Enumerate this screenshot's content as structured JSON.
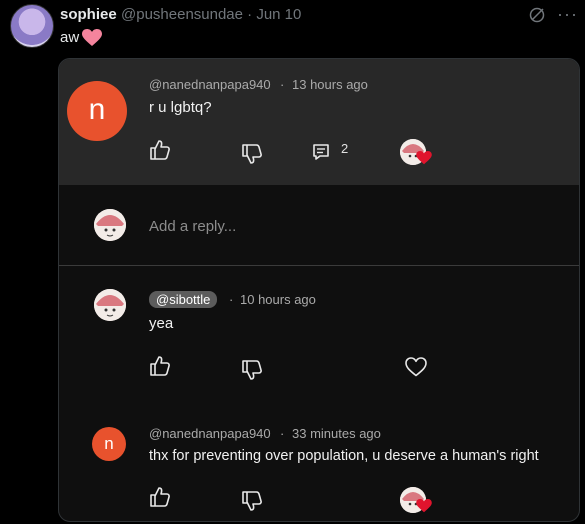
{
  "tweet": {
    "display_name": "sophiee",
    "handle_and_date": "@pusheensundae · Jun 10",
    "text": "aw",
    "emoji_icon": "pink-heart-icon"
  },
  "comments": [
    {
      "author": "@nanednanpapa940",
      "time": "13 hours ago",
      "text": "r u lgbtq?",
      "avatar_letter": "n",
      "reply_count": "2"
    },
    {
      "author": "@sibottle",
      "time": "10 hours ago",
      "text": "yea"
    },
    {
      "author": "@nanednanpapa940",
      "time": "33 minutes ago",
      "text": "thx for preventing over population, u deserve a human's right",
      "avatar_letter": "n"
    }
  ],
  "reply_box": {
    "placeholder": "Add a reply..."
  },
  "separator": "·",
  "colors": {
    "avatar_orange": "#e8522d",
    "heart_red": "#e0142d",
    "background": "#000000",
    "panel": "#282828"
  }
}
